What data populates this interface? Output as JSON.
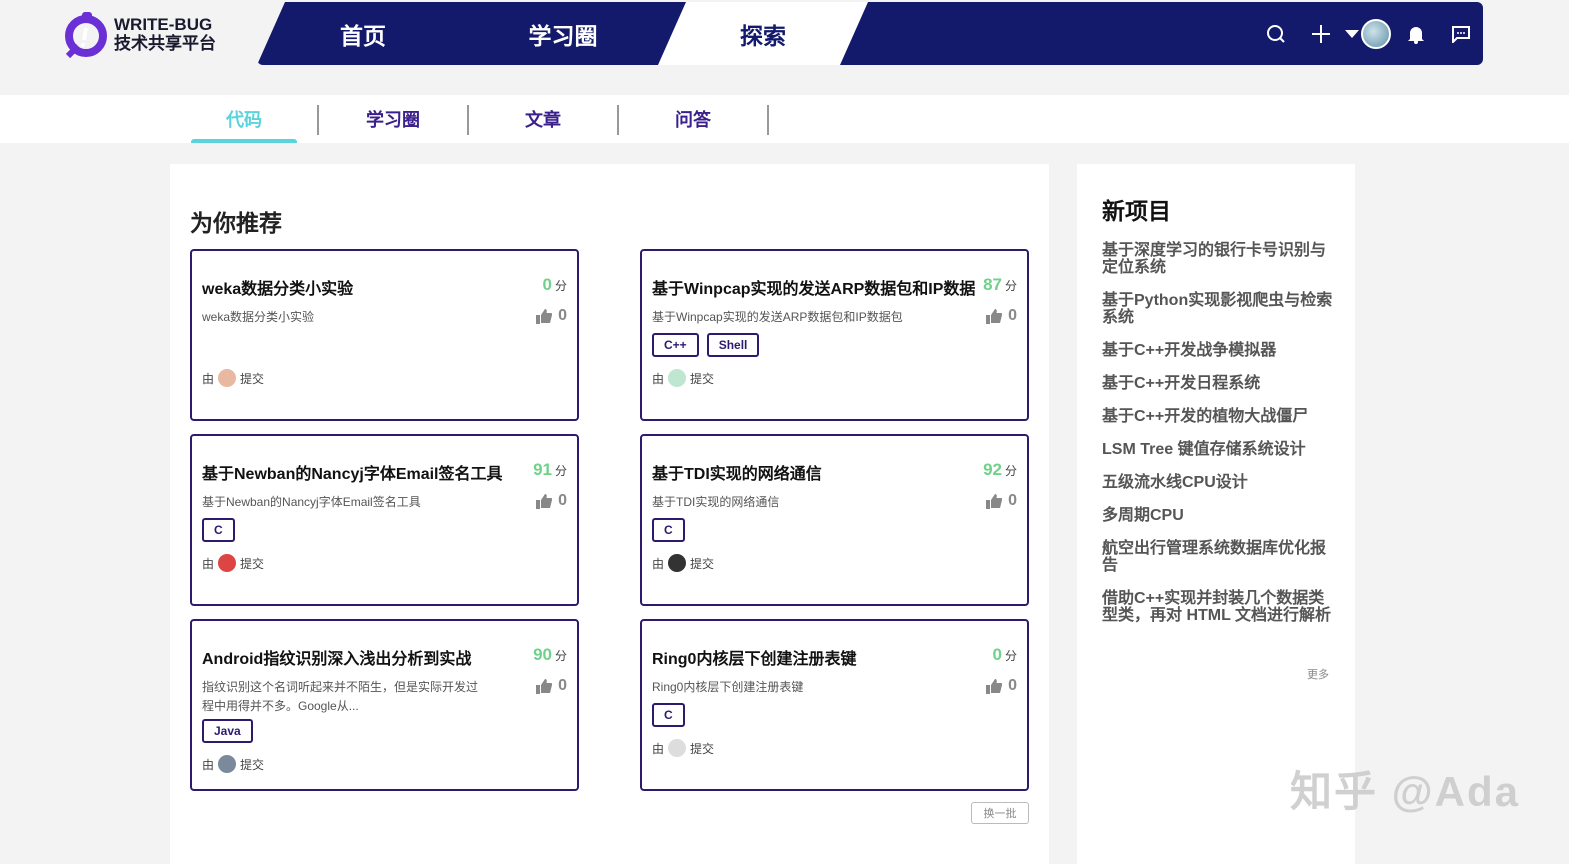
{
  "logo": {
    "line1": "WRITE-BUG",
    "line2": "技术共享平台"
  },
  "nav": {
    "items": [
      {
        "label": "首页"
      },
      {
        "label": "学习圈"
      },
      {
        "label": "探索",
        "active": true
      }
    ]
  },
  "subnav": {
    "items": [
      {
        "label": "代码",
        "active": true
      },
      {
        "label": "学习圈"
      },
      {
        "label": "文章"
      },
      {
        "label": "问答"
      }
    ]
  },
  "recommend": {
    "title": "为你推荐",
    "by_prefix": "由",
    "by_suffix": "提交",
    "score_unit": "分",
    "refresh_label": "换一批",
    "cards": [
      {
        "title": "weka数据分类小实验",
        "score": "0",
        "desc": "weka数据分类小实验",
        "likes": "0",
        "tags": []
      },
      {
        "title": "基于Winpcap实现的发送ARP数据包和IP数据",
        "score": "87",
        "desc": "基于Winpcap实现的发送ARP数据包和IP数据包",
        "likes": "0",
        "tags": [
          "C++",
          "Shell"
        ]
      },
      {
        "title": "基于Newban的Nancyj字体Email签名工具",
        "score": "91",
        "desc": "基于Newban的Nancyj字体Email签名工具",
        "likes": "0",
        "tags": [
          "C"
        ]
      },
      {
        "title": "基于TDI实现的网络通信",
        "score": "92",
        "desc": "基于TDI实现的网络通信",
        "likes": "0",
        "tags": [
          "C"
        ]
      },
      {
        "title": "Android指纹识别深入浅出分析到实战",
        "score": "90",
        "desc": "指纹识别这个名词听起来并不陌生，但是实际开发过程中用得并不多。Google从...",
        "likes": "0",
        "tags": [
          "Java"
        ]
      },
      {
        "title": "Ring0内核层下创建注册表键",
        "score": "0",
        "desc": "Ring0内核层下创建注册表键",
        "likes": "0",
        "tags": [
          "C"
        ]
      }
    ]
  },
  "sidebar": {
    "title": "新项目",
    "more_label": "更多",
    "items": [
      "基于深度学习的银行卡号识别与定位系统",
      "基于Python实现影视爬虫与检索系统",
      "基于C++开发战争模拟器",
      "基于C++开发日程系统",
      "基于C++开发的植物大战僵尸",
      "LSM Tree 键值存储系统设计",
      "五级流水线CPU设计",
      "多周期CPU",
      "航空出行管理系统数据库优化报告",
      "借助C++实现并封装几个数据类型类，再对 HTML 文档进行解析"
    ]
  },
  "watermark": "知乎 @Ada",
  "colors": {
    "nav": "#131a6b",
    "accent": "#5ad3dd",
    "score": "#6fd18a",
    "border": "#2d1a6e"
  }
}
